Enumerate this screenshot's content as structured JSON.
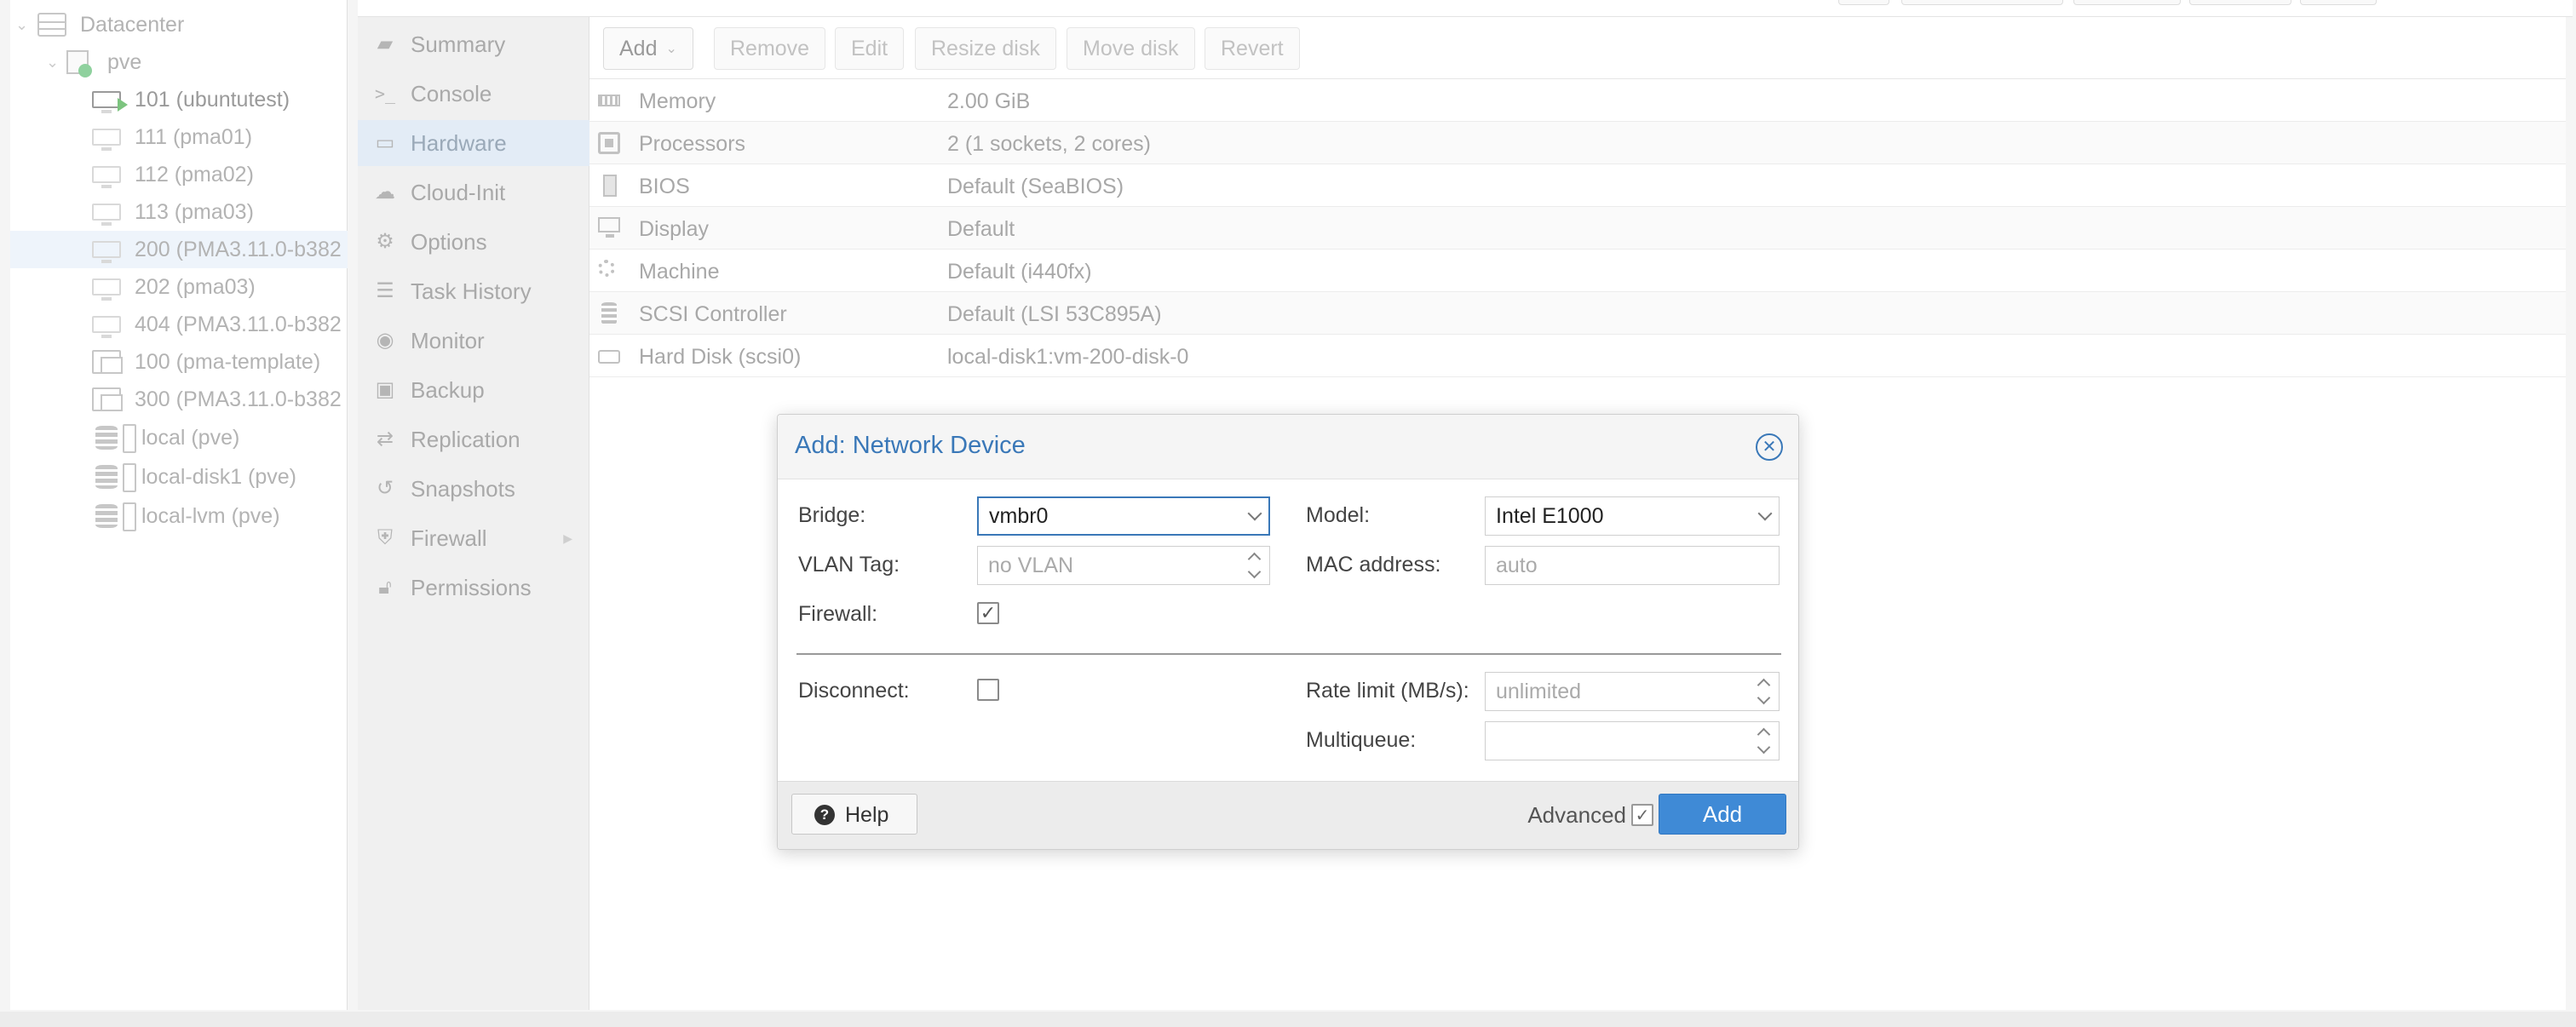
{
  "tree": {
    "items": [
      {
        "label": "Datacenter",
        "icon": "server-icon"
      },
      {
        "label": "pve",
        "icon": "node-icon"
      },
      {
        "label": "101 (ubuntutest)",
        "icon": "vm-running-icon"
      },
      {
        "label": "111 (pma01)",
        "icon": "vm-icon"
      },
      {
        "label": "112 (pma02)",
        "icon": "vm-icon"
      },
      {
        "label": "113 (pma03)",
        "icon": "vm-icon"
      },
      {
        "label": "200 (PMA3.11.0-b382",
        "icon": "vm-icon"
      },
      {
        "label": "202 (pma03)",
        "icon": "vm-icon"
      },
      {
        "label": "404 (PMA3.11.0-b382",
        "icon": "vm-icon"
      },
      {
        "label": "100 (pma-template)",
        "icon": "template-icon"
      },
      {
        "label": "300 (PMA3.11.0-b382",
        "icon": "template-icon"
      },
      {
        "label": "local (pve)",
        "icon": "storage-icon"
      },
      {
        "label": "local-disk1 (pve)",
        "icon": "storage-icon"
      },
      {
        "label": "local-lvm (pve)",
        "icon": "storage-icon"
      }
    ],
    "selected": "200 (PMA3.11.0-b382"
  },
  "submenu": {
    "items": [
      {
        "label": "Summary",
        "icon": "book-icon"
      },
      {
        "label": "Console",
        "icon": "terminal-icon"
      },
      {
        "label": "Hardware",
        "icon": "desktop-icon"
      },
      {
        "label": "Cloud-Init",
        "icon": "cloud-icon"
      },
      {
        "label": "Options",
        "icon": "gear-icon"
      },
      {
        "label": "Task History",
        "icon": "list-icon"
      },
      {
        "label": "Monitor",
        "icon": "eye-icon"
      },
      {
        "label": "Backup",
        "icon": "floppy-icon"
      },
      {
        "label": "Replication",
        "icon": "retweet-icon"
      },
      {
        "label": "Snapshots",
        "icon": "history-icon"
      },
      {
        "label": "Firewall",
        "icon": "shield-icon"
      },
      {
        "label": "Permissions",
        "icon": "unlock-icon"
      }
    ],
    "active": "Hardware"
  },
  "toolbar": {
    "add": "Add",
    "remove": "Remove",
    "edit": "Edit",
    "resize_disk": "Resize disk",
    "move_disk": "Move disk",
    "revert": "Revert"
  },
  "hardware": {
    "rows": [
      {
        "name": "Memory",
        "value": "2.00 GiB",
        "icon": "memory-icon"
      },
      {
        "name": "Processors",
        "value": "2 (1 sockets, 2 cores)",
        "icon": "cpu-icon"
      },
      {
        "name": "BIOS",
        "value": "Default (SeaBIOS)",
        "icon": "bios-icon"
      },
      {
        "name": "Display",
        "value": "Default",
        "icon": "display-icon"
      },
      {
        "name": "Machine",
        "value": "Default (i440fx)",
        "icon": "machine-icon"
      },
      {
        "name": "SCSI Controller",
        "value": "Default (LSI 53C895A)",
        "icon": "database-icon"
      },
      {
        "name": "Hard Disk (scsi0)",
        "value": "local-disk1:vm-200-disk-0",
        "icon": "hdd-icon"
      }
    ]
  },
  "dialog": {
    "title": "Add: Network Device",
    "bridge_label": "Bridge:",
    "bridge_value": "vmbr0",
    "model_label": "Model:",
    "model_value": "Intel E1000",
    "vlan_label": "VLAN Tag:",
    "vlan_placeholder": "no VLAN",
    "mac_label": "MAC address:",
    "mac_placeholder": "auto",
    "firewall_label": "Firewall:",
    "firewall_checked": true,
    "disconnect_label": "Disconnect:",
    "disconnect_checked": false,
    "rate_label": "Rate limit (MB/s):",
    "rate_placeholder": "unlimited",
    "multiqueue_label": "Multiqueue:",
    "multiqueue_value": "",
    "help_label": "Help",
    "advanced_label": "Advanced",
    "advanced_checked": true,
    "add_label": "Add"
  },
  "colors": {
    "accent": "#3a78b8",
    "primary_button": "#3f8ad6"
  }
}
